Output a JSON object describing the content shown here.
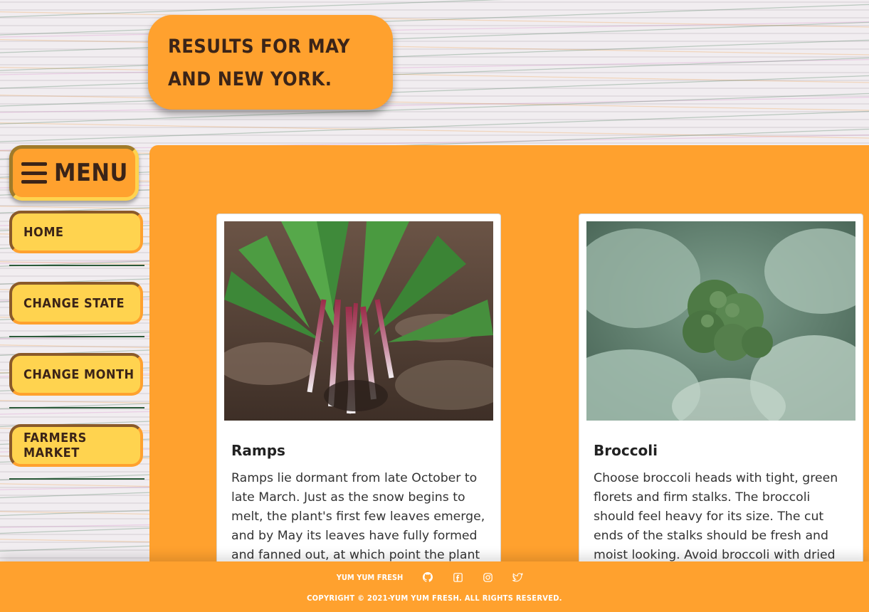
{
  "header": {
    "title": "Results for May and New York."
  },
  "menu": {
    "label": "Menu",
    "icon": "hamburger-icon"
  },
  "sidebar": {
    "items": [
      {
        "label": "Home"
      },
      {
        "label": "Change State"
      },
      {
        "label": "Change Month"
      },
      {
        "label": "Farmers Market"
      }
    ]
  },
  "cards": [
    {
      "title": "Ramps",
      "text": "Ramps lie dormant from late October to late March. Just as the snow begins to melt, the plant's first few leaves emerge, and by May its leaves have fully formed and fanned out, at which point the plant is usually harvested.",
      "image": "ramps-photo"
    },
    {
      "title": "Broccoli",
      "text": "Choose broccoli heads with tight, green florets and firm stalks. The broccoli should feel heavy for its size. The cut ends of the stalks should be fresh and moist looking. Avoid broccoli with dried out or browning",
      "image": "broccoli-photo"
    }
  ],
  "footer": {
    "brand": "Yum Yum Fresh",
    "icons": [
      "github-icon",
      "facebook-icon",
      "instagram-icon",
      "twitter-icon"
    ],
    "copyright": "Copyright © 2021-Yum Yum Fresh. All rights reserved."
  },
  "colors": {
    "accent_orange": "#ffa12e",
    "accent_yellow": "#ffd34f",
    "text_dark": "#3b2418"
  }
}
